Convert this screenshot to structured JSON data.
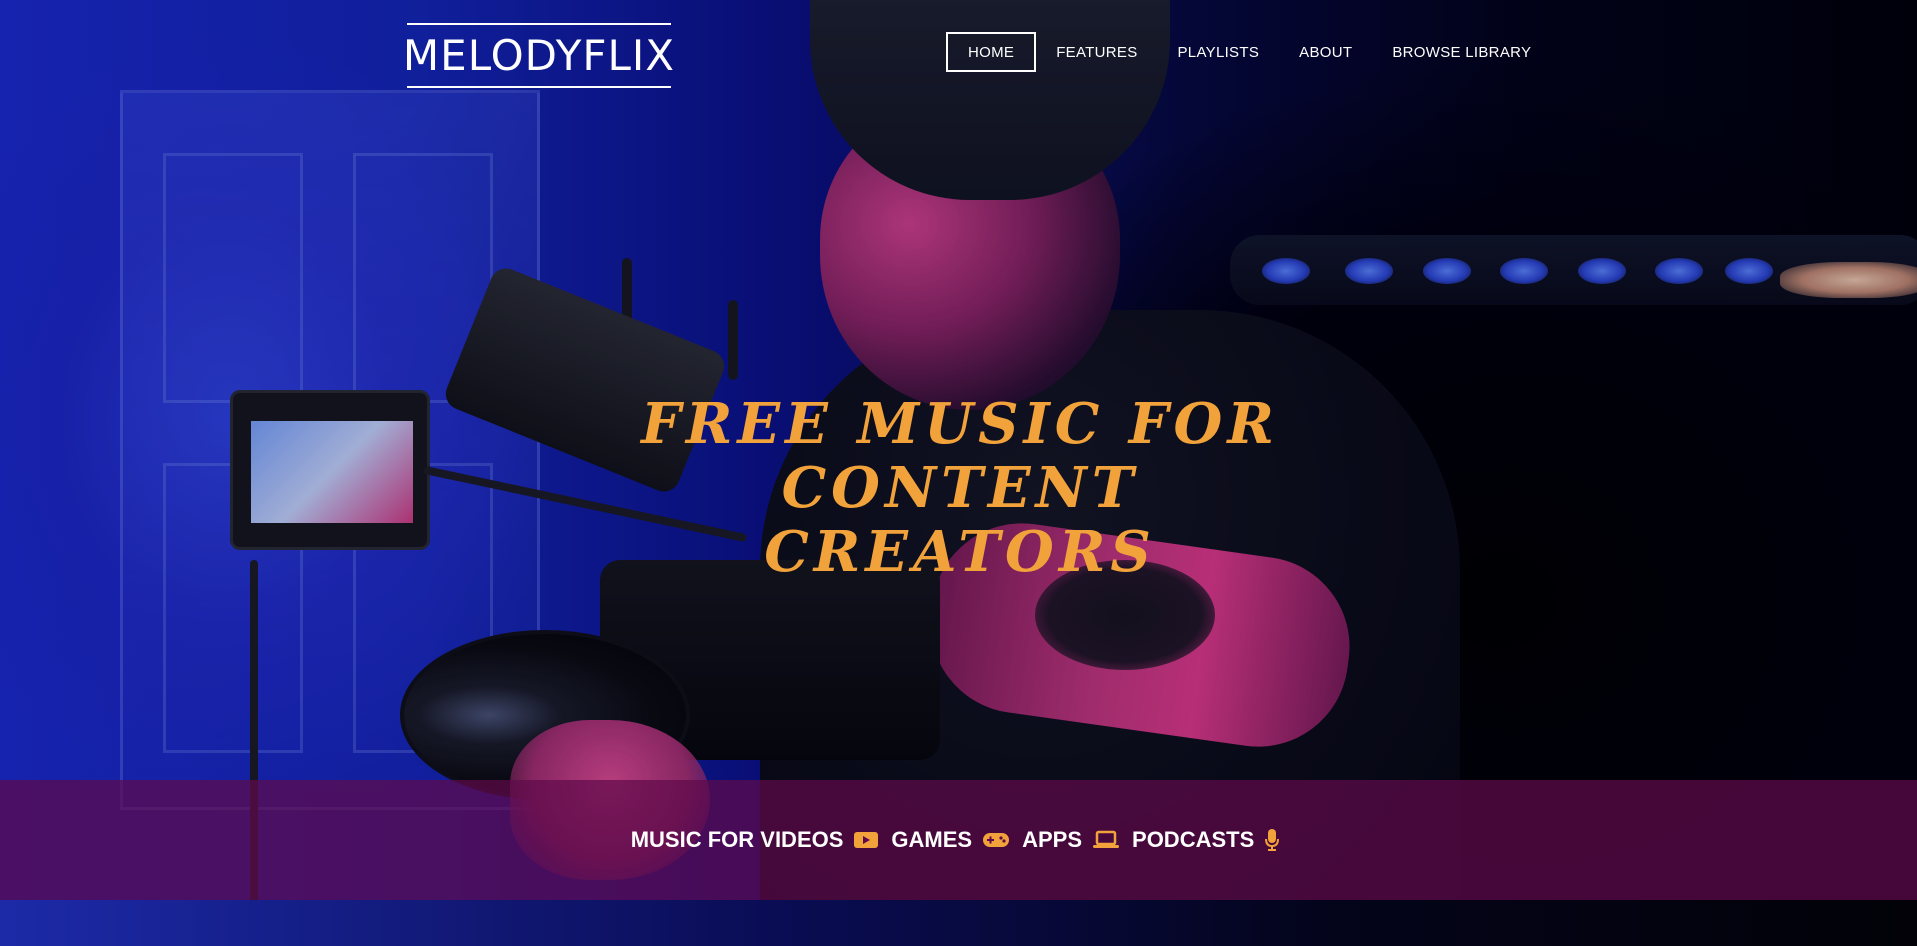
{
  "brand": {
    "logo_text": "MELODYFLIX"
  },
  "nav": {
    "items": [
      {
        "label": "HOME",
        "active": true
      },
      {
        "label": "FEATURES",
        "active": false
      },
      {
        "label": "PLAYLISTS",
        "active": false
      },
      {
        "label": "ABOUT",
        "active": false
      },
      {
        "label": "BROWSE LIBRARY",
        "active": false
      }
    ]
  },
  "hero": {
    "headline_line1": "FREE MUSIC FOR CONTENT",
    "headline_line2": "CREATORS",
    "image": "man-operating-cinema-camera-neon-lighting"
  },
  "band": {
    "items": [
      {
        "label": "MUSIC FOR VIDEOS",
        "icon": "video-play-icon"
      },
      {
        "label": "GAMES",
        "icon": "gamepad-icon"
      },
      {
        "label": "APPS",
        "icon": "laptop-icon"
      },
      {
        "label": "PODCASTS",
        "icon": "microphone-icon"
      }
    ]
  },
  "colors": {
    "headline": "#f2a23a",
    "icon_accent": "#f2a23a",
    "band_background": "#5f0a4b",
    "text": "#ffffff"
  }
}
